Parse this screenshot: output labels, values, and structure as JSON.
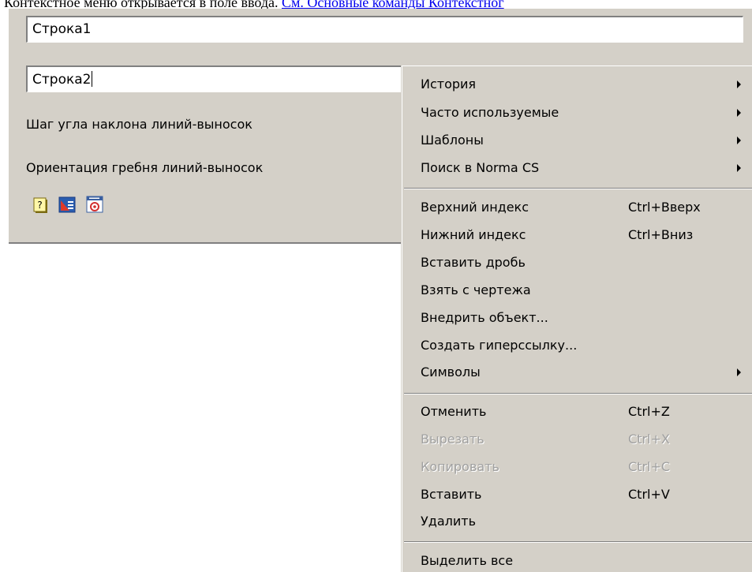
{
  "doc": {
    "intro_text": "Контекстное меню открывается в поле ввода. ",
    "intro_link": "См. Основные команды Контекстног"
  },
  "dialog": {
    "field1_value": "Строка1",
    "field2_value": "Строка2",
    "label1": "Шаг угла наклона линий-выносок",
    "label2": "Ориентация гребня линий-выносок",
    "icons": [
      "help-icon",
      "table-icon",
      "gost-settings-icon"
    ]
  },
  "context_menu": {
    "group1": [
      {
        "label": "История",
        "submenu": true
      },
      {
        "label": "Часто используемые",
        "submenu": true
      },
      {
        "label": "Шаблоны",
        "submenu": true
      },
      {
        "label": "Поиск в Norma CS",
        "submenu": true
      }
    ],
    "group2": [
      {
        "label": "Верхний индекс",
        "shortcut": "Ctrl+Вверх"
      },
      {
        "label": "Нижний индекс",
        "shortcut": "Ctrl+Вниз"
      },
      {
        "label": "Вставить дробь"
      },
      {
        "label": "Взять с чертежа"
      },
      {
        "label": "Внедрить объект..."
      },
      {
        "label": "Создать гиперссылку..."
      },
      {
        "label": "Символы",
        "submenu": true
      }
    ],
    "group3": [
      {
        "label": "Отменить",
        "shortcut": "Ctrl+Z",
        "enabled": true
      },
      {
        "label": "Вырезать",
        "shortcut": "Ctrl+X",
        "enabled": false
      },
      {
        "label": "Копировать",
        "shortcut": "Ctrl+C",
        "enabled": false
      },
      {
        "label": "Вставить",
        "shortcut": "Ctrl+V",
        "enabled": true
      },
      {
        "label": "Удалить",
        "enabled": true
      }
    ],
    "group4": [
      {
        "label": "Выделить все"
      }
    ]
  },
  "colors": {
    "dialog_bg": "#d4d0c8",
    "link": "#0000ee",
    "disabled_text": "#a0a0a0"
  }
}
